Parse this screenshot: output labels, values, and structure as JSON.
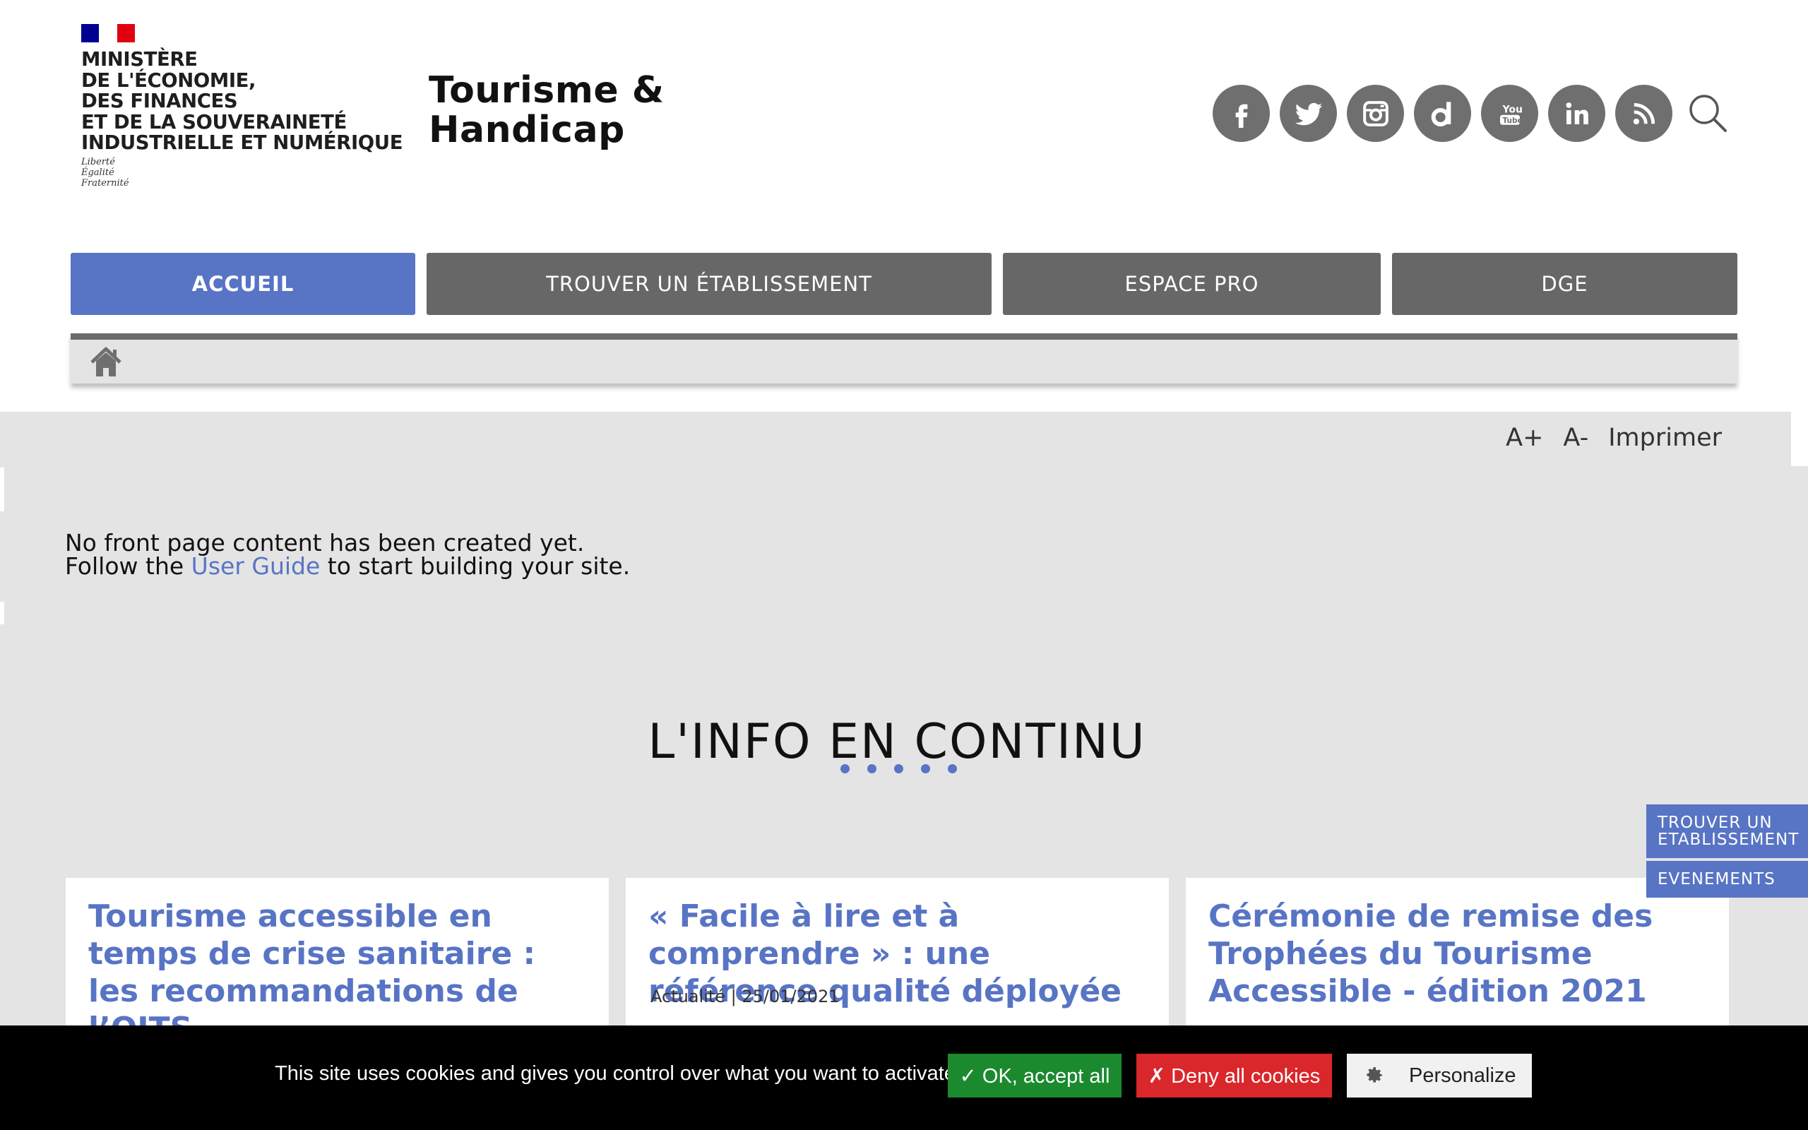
{
  "header": {
    "ministry_lines": [
      "MINISTÈRE",
      "DE L'ÉCONOMIE,",
      "DES FINANCES",
      "ET DE LA SOUVERAINETÉ",
      "INDUSTRIELLE ET NUMÉRIQUE"
    ],
    "motto_lines": [
      "Liberté",
      "Égalité",
      "Fraternité"
    ],
    "site_title_line1": "Tourisme &",
    "site_title_line2": "Handicap",
    "social_icons": [
      "facebook-icon",
      "twitter-icon",
      "instagram-icon",
      "dailymotion-icon",
      "youtube-icon",
      "linkedin-icon",
      "rss-icon"
    ]
  },
  "nav": {
    "items": [
      {
        "label": "ACCUEIL",
        "active": true
      },
      {
        "label": "TROUVER UN ÉTABLISSEMENT",
        "active": false
      },
      {
        "label": "ESPACE PRO",
        "active": false
      },
      {
        "label": "DGE",
        "active": false
      }
    ]
  },
  "tools": {
    "increase": "A+",
    "decrease": "A-",
    "print": "Imprimer"
  },
  "front": {
    "line1": "No front page content has been created yet.",
    "line2_before": "Follow the",
    "line2_link": "User Guide",
    "line2_after": "to start building your site."
  },
  "section": {
    "title": "L'INFO EN CONTINU"
  },
  "cards": [
    {
      "title": "Tourisme accessible en temps de crise sanitaire : les recommandations de l’OITS",
      "meta": ""
    },
    {
      "title": "« Facile à lire et à comprendre » : une référence qualité déployée",
      "meta": "Actualité | 25/01/2021"
    },
    {
      "title": "Cérémonie de remise des Trophées du Tourisme Accessible - édition 2021",
      "meta": ""
    }
  ],
  "side_tabs": {
    "tab1_line1": "TROUVER UN",
    "tab1_line2": "ETABLISSEMENT",
    "tab2": "EVENEMENTS"
  },
  "cookie": {
    "text": "This site uses cookies and gives you control over what you want to activate",
    "accept": "✓ OK, accept all",
    "deny": "✗ Deny all cookies",
    "personalize": "Personalize"
  },
  "colors": {
    "accent": "#5874c4",
    "nav_grey": "#676767",
    "page_grey": "#e4e4e4",
    "accept_green": "#1b8a2f",
    "deny_red": "#d9272b"
  }
}
